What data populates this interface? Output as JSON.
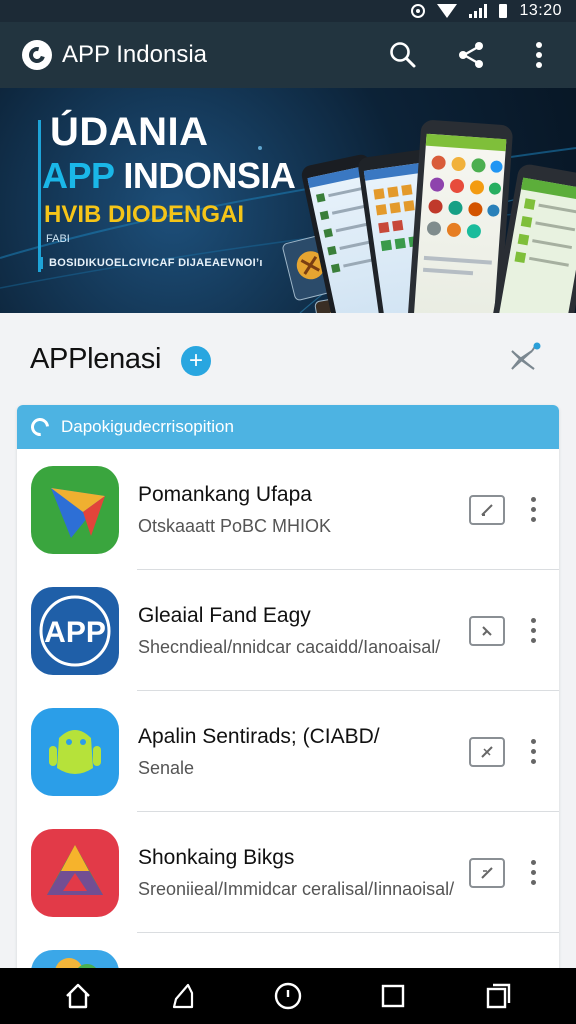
{
  "status_bar": {
    "time": "13:20",
    "icons": [
      "target-icon",
      "wifi-icon",
      "signal-icon",
      "battery-icon"
    ]
  },
  "app_bar": {
    "title": "APP Indonsia",
    "logo_icon": "app-logo-icon",
    "actions": [
      "search-icon",
      "share-icon",
      "more-vert-icon"
    ]
  },
  "banner": {
    "line1": "ÚDANIA",
    "line2_accent": "APP",
    "line2_rest": "INDONSIA",
    "line3": "HVIB DIODENGAI",
    "line4": "FABI",
    "line5": "BOSIDIKUOELCIVICAF DIJAEAEVNOI’ı",
    "colors": {
      "accent": "#1ab7e8",
      "highlight": "#f5c518",
      "background": "#0c2237"
    }
  },
  "section": {
    "title": "APPlenasi",
    "badge_icon": "plus-icon",
    "action_icon": "network-icon"
  },
  "card": {
    "header_text": "Dapokigudecrrisopition",
    "header_icon": "refresh-icon",
    "items": [
      {
        "title": "Pomankang Ufapa",
        "subtitle": "Otskaaatt PoBC MHIOK",
        "icon": "green-app-icon"
      },
      {
        "title": "Gleaial Fand Eagy",
        "subtitle": "Shecndieal/nnidcar cacaidd/Ianoaisal/",
        "icon": "app-badge-icon",
        "icon_text": "APP"
      },
      {
        "title": "Apalin Sentirads; (CIABD/",
        "subtitle": "Senale",
        "icon": "android-app-icon"
      },
      {
        "title": "Shonkaing Bikgs",
        "subtitle": "Sreoniieal/Immidcar ceralisal/Iinnaoisal/",
        "icon": "triangle-app-icon"
      }
    ]
  },
  "nav_bar": {
    "buttons": [
      "home-icon",
      "back-icon",
      "circle-home-icon",
      "square-icon",
      "recent-apps-icon"
    ]
  }
}
